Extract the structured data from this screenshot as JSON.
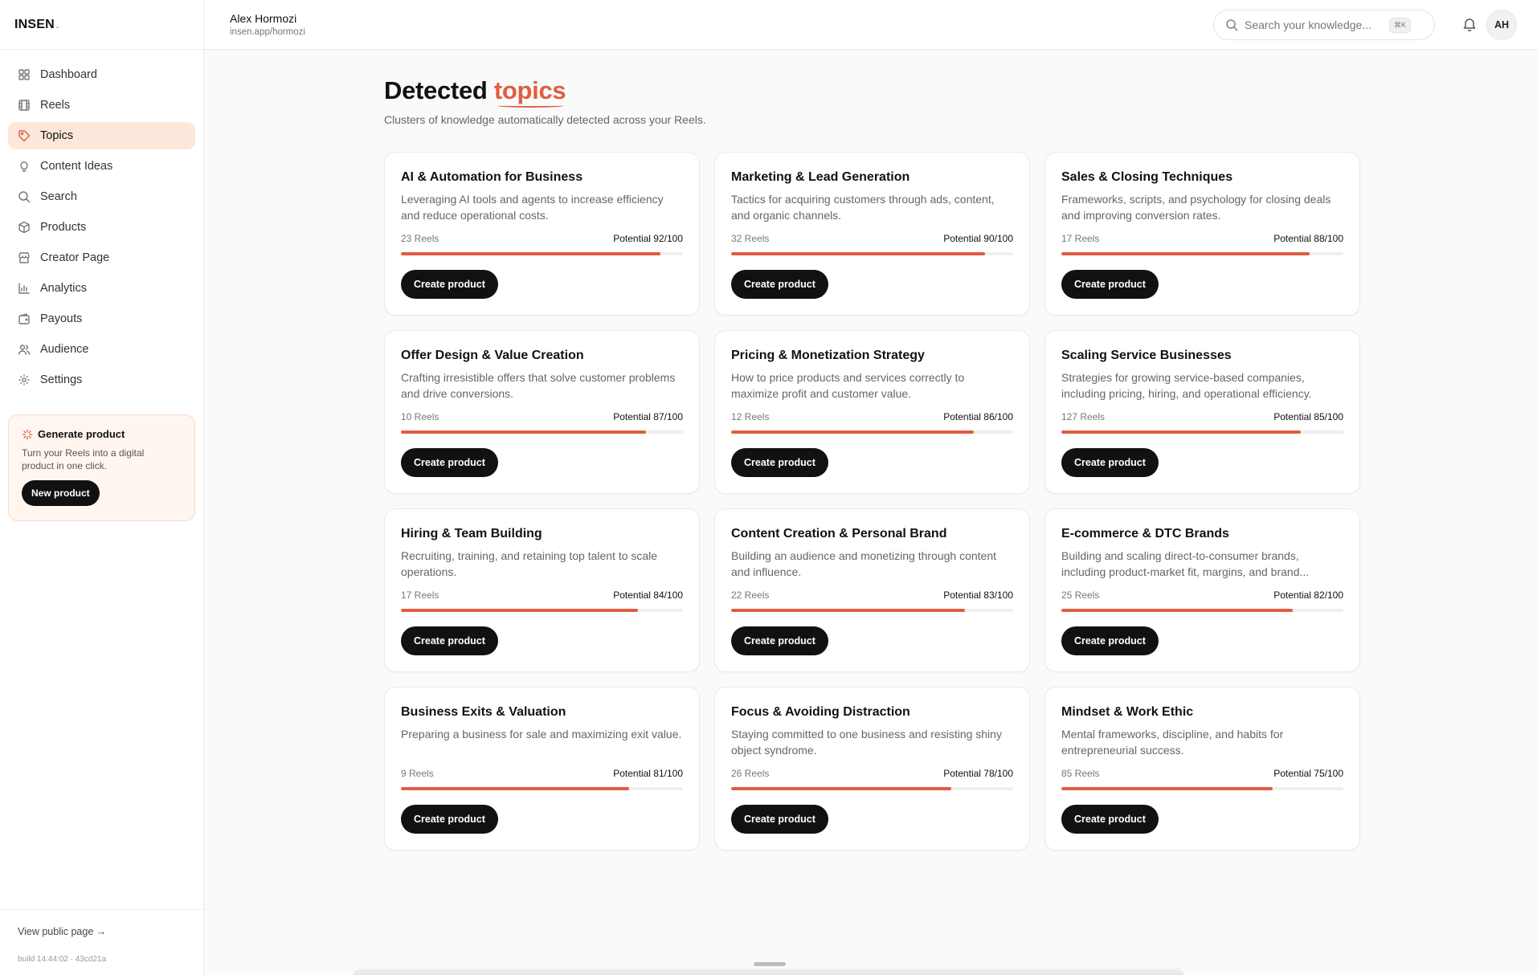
{
  "brand": {
    "name": "INSEN",
    "dot": "."
  },
  "sidebar": {
    "items": [
      {
        "label": "Dashboard",
        "icon": "grid-icon"
      },
      {
        "label": "Reels",
        "icon": "film-icon"
      },
      {
        "label": "Topics",
        "icon": "tag-icon",
        "active": true
      },
      {
        "label": "Content Ideas",
        "icon": "lightbulb-icon"
      },
      {
        "label": "Search",
        "icon": "search-icon"
      },
      {
        "label": "Products",
        "icon": "box-icon"
      },
      {
        "label": "Creator Page",
        "icon": "store-icon"
      },
      {
        "label": "Analytics",
        "icon": "bar-chart-icon"
      },
      {
        "label": "Payouts",
        "icon": "wallet-icon"
      },
      {
        "label": "Audience",
        "icon": "users-icon"
      },
      {
        "label": "Settings",
        "icon": "gear-icon"
      }
    ],
    "generate": {
      "title": "Generate product",
      "description": "Turn your Reels into a digital product in one click.",
      "button": "New product"
    },
    "public_link": "View public page →",
    "build": "build 14:44:02 · 43cd21a"
  },
  "header": {
    "user_name": "Alex Hormozi",
    "user_url": "insen.app/hormozi",
    "search_placeholder": "Search your knowledge...",
    "shortcut": "⌘K",
    "avatar": "AH"
  },
  "page": {
    "title_prefix": "Detected",
    "title_accent": "topics",
    "subtitle": "Clusters of knowledge automatically detected across your Reels."
  },
  "colors": {
    "accent": "#e25c40",
    "dark": "#111111"
  },
  "topics": [
    {
      "title": "AI & Automation for Business",
      "description": "Leveraging AI tools and agents to increase efficiency and reduce operational costs.",
      "reels": "23 Reels",
      "potential": "Potential 92/100",
      "score": 92,
      "button": "Create product"
    },
    {
      "title": "Marketing & Lead Generation",
      "description": "Tactics for acquiring customers through ads, content, and organic channels.",
      "reels": "32 Reels",
      "potential": "Potential 90/100",
      "score": 90,
      "button": "Create product"
    },
    {
      "title": "Sales & Closing Techniques",
      "description": "Frameworks, scripts, and psychology for closing deals and improving conversion rates.",
      "reels": "17 Reels",
      "potential": "Potential 88/100",
      "score": 88,
      "button": "Create product"
    },
    {
      "title": "Offer Design & Value Creation",
      "description": "Crafting irresistible offers that solve customer problems and drive conversions.",
      "reels": "10 Reels",
      "potential": "Potential 87/100",
      "score": 87,
      "button": "Create product"
    },
    {
      "title": "Pricing & Monetization Strategy",
      "description": "How to price products and services correctly to maximize profit and customer value.",
      "reels": "12 Reels",
      "potential": "Potential 86/100",
      "score": 86,
      "button": "Create product"
    },
    {
      "title": "Scaling Service Businesses",
      "description": "Strategies for growing service-based companies, including pricing, hiring, and operational efficiency.",
      "reels": "127 Reels",
      "potential": "Potential 85/100",
      "score": 85,
      "button": "Create product"
    },
    {
      "title": "Hiring & Team Building",
      "description": "Recruiting, training, and retaining top talent to scale operations.",
      "reels": "17 Reels",
      "potential": "Potential 84/100",
      "score": 84,
      "button": "Create product"
    },
    {
      "title": "Content Creation & Personal Brand",
      "description": "Building an audience and monetizing through content and influence.",
      "reels": "22 Reels",
      "potential": "Potential 83/100",
      "score": 83,
      "button": "Create product"
    },
    {
      "title": "E-commerce & DTC Brands",
      "description": "Building and scaling direct-to-consumer brands, including product-market fit, margins, and brand...",
      "reels": "25 Reels",
      "potential": "Potential 82/100",
      "score": 82,
      "button": "Create product"
    },
    {
      "title": "Business Exits & Valuation",
      "description": "Preparing a business for sale and maximizing exit value.",
      "reels": "9 Reels",
      "potential": "Potential 81/100",
      "score": 81,
      "button": "Create product"
    },
    {
      "title": "Focus & Avoiding Distraction",
      "description": "Staying committed to one business and resisting shiny object syndrome.",
      "reels": "26 Reels",
      "potential": "Potential 78/100",
      "score": 78,
      "button": "Create product"
    },
    {
      "title": "Mindset & Work Ethic",
      "description": "Mental frameworks, discipline, and habits for entrepreneurial success.",
      "reels": "85 Reels",
      "potential": "Potential 75/100",
      "score": 75,
      "button": "Create product"
    }
  ]
}
